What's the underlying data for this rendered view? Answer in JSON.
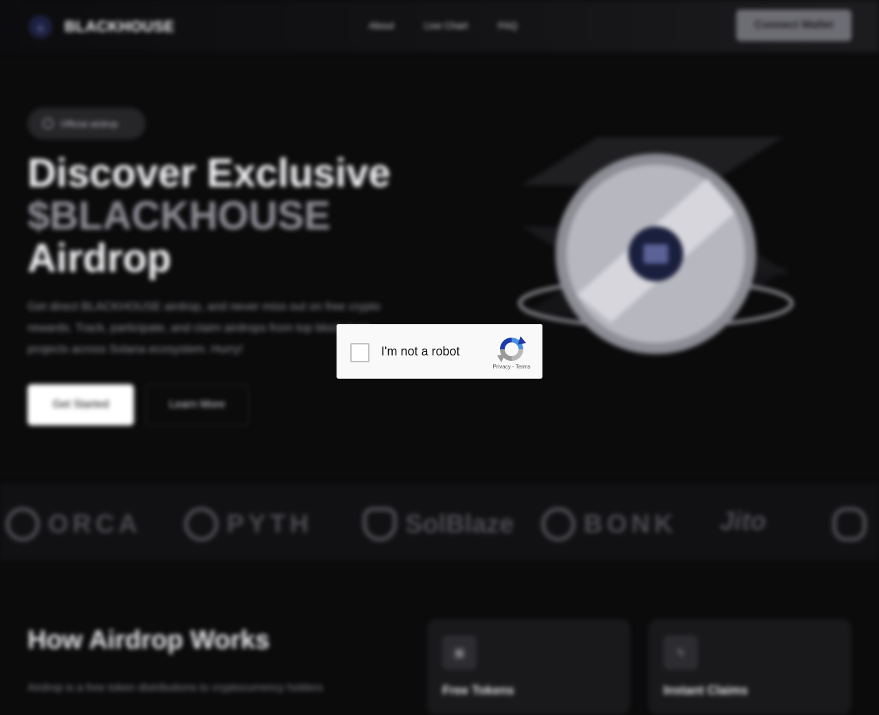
{
  "header": {
    "logo_text": "BLACKHOUSE",
    "nav": [
      "About",
      "Live Chart",
      "FAQ"
    ],
    "connect_label": "Connect Wallet"
  },
  "hero": {
    "badge": "Official airdrop",
    "title_line1": "Discover Exclusive",
    "title_line2": "$BLACKHOUSE",
    "title_line3": "Airdrop",
    "description": "Get direct BLACKHOUSE airdrop, and never miss out on free crypto rewards. Track, participate, and claim airdrops from top blockchain projects across Solana ecosystem. Hurry!",
    "primary_button": "Get Started",
    "secondary_button": "Learn More"
  },
  "partners": [
    "ORCA",
    "PYTH",
    "SolBlaze",
    "BONK",
    "Jito"
  ],
  "how": {
    "title": "How Airdrop Works",
    "description": "Airdrop is a free token distributions to cryptocurrency holders",
    "cards": [
      {
        "icon": "gift-icon",
        "title": "Free Tokens"
      },
      {
        "icon": "lightning-icon",
        "title": "Instant Claims"
      }
    ]
  },
  "captcha": {
    "label": "I'm not a robot",
    "privacy": "Privacy",
    "separator": " - ",
    "terms": "Terms"
  }
}
